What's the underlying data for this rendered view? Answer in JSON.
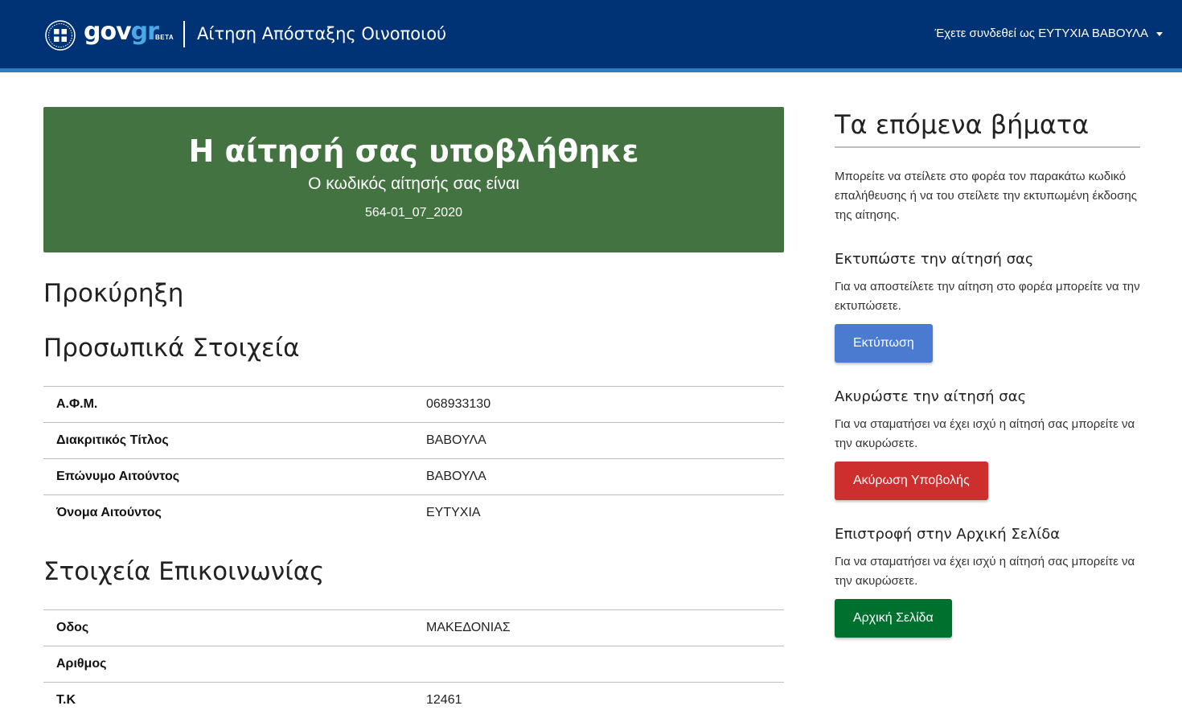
{
  "header": {
    "logo_gov": "gov",
    "logo_gr": "gr",
    "logo_beta": "BETA",
    "service_title": "Αίτηση Απόσταξης Οινοποιού",
    "user_label": "Έχετε συνδεθεί ως ΕΥΤΥΧΙΑ ΒΑΒΟΥΛΑ"
  },
  "banner": {
    "title": "Η αίτησή σας υποβλήθηκε",
    "subtitle": "Ο κωδικός αίτησής σας είναι",
    "code": "564-01_07_2020"
  },
  "sections": {
    "proclamation": "Προκύρηξη",
    "personal": {
      "title": "Προσωπικά Στοιχεία",
      "rows": [
        {
          "label": "Α.Φ.Μ.",
          "value": "068933130"
        },
        {
          "label": "Διακριτικός Τίτλος",
          "value": "ΒΑΒΟΥΛΑ"
        },
        {
          "label": "Επώνυμο Αιτούντος",
          "value": "ΒΑΒΟΥΛΑ"
        },
        {
          "label": "Όνομα Αιτούντος",
          "value": "ΕΥΤΥΧΙΑ"
        }
      ]
    },
    "contact": {
      "title": "Στοιχεία Επικοινωνίας",
      "rows": [
        {
          "label": "Οδος",
          "value": "ΜΑΚΕΔΟΝΙΑΣ"
        },
        {
          "label": "Αριθμος",
          "value": ""
        },
        {
          "label": "Τ.Κ",
          "value": "12461"
        }
      ]
    }
  },
  "side": {
    "title": "Τα επόμενα βήματα",
    "intro": "Μπορείτε να στείλετε στο φορέα τον παρακάτω κωδικό επαλήθευσης ή να του στείλετε την εκτυπωμένη έκδοσης της αίτησης.",
    "print": {
      "title": "Εκτυπώστε την αίτησή σας",
      "text": "Για να αποστείλετε την αίτηση στο φορέα μπορείτε να την εκτυπώσετε.",
      "button": "Εκτύπωση"
    },
    "cancel": {
      "title": "Ακυρώστε την αίτησή σας",
      "text": "Για να σταματήσει να έχει ισχύ η αίτησή σας μπορείτε να την ακυρώσετε.",
      "button": "Ακύρωση Υποβολής"
    },
    "home": {
      "title": "Επιστροφή στην Αρχική Σελίδα",
      "text": "Για να σταματήσει να έχει ισχύ η αίτησή σας μπορείτε να την ακυρώσετε.",
      "button": "Αρχική Σελίδα"
    }
  },
  "colors": {
    "header_bg": "#003375",
    "banner_bg": "#427340",
    "print_button": "#4a7bd0",
    "cancel_button": "#cd2e2e",
    "home_button": "#00702f"
  }
}
